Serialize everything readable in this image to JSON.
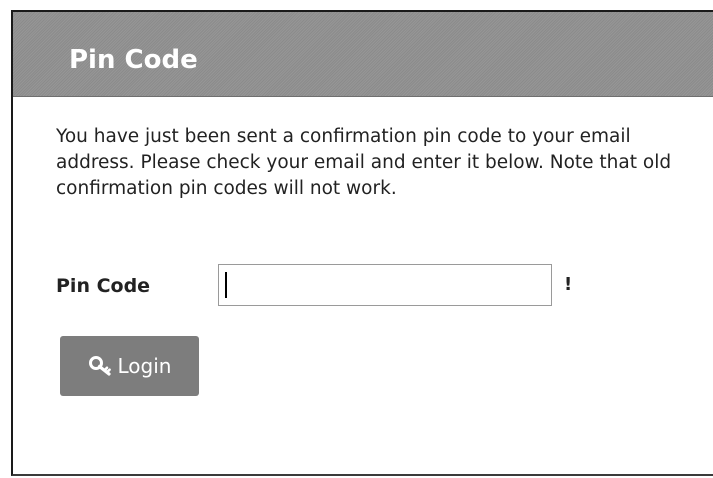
{
  "dialog": {
    "title": "Pin Code",
    "message": "You have just been sent a confirmation pin code to your email address. Please check your email and enter it below. Note that old confirmation pin codes will not work."
  },
  "form": {
    "pin_label": "Pin Code",
    "pin_value": "",
    "pin_placeholder": "",
    "required_marker": "!"
  },
  "actions": {
    "login_label": "Login",
    "login_icon": "key-icon"
  },
  "colors": {
    "header_background": "#8f8f8f",
    "button_background": "#7d7d7d",
    "header_text": "#ffffff"
  }
}
